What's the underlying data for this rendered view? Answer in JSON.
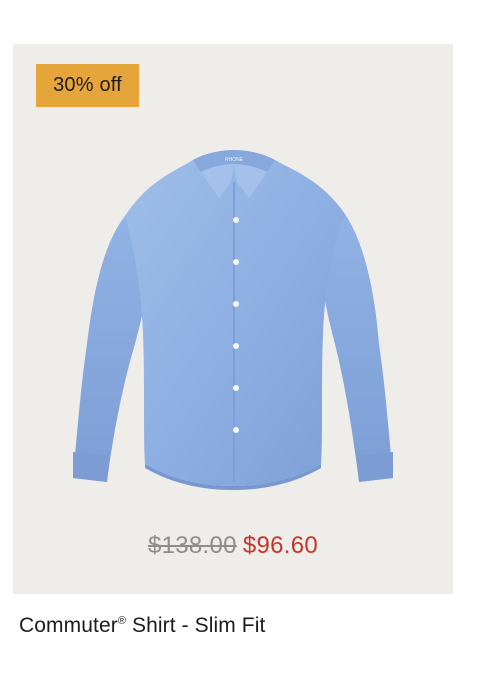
{
  "product": {
    "discount_badge": "30% off",
    "image_alt": "Blue long sleeve button-up shirt",
    "label_on_collar": "RHONE",
    "price_original": "$138.00",
    "price_sale": "$96.60",
    "title_main": "Commuter",
    "title_mark": "®",
    "title_rest": " Shirt - Slim Fit"
  },
  "colors": {
    "card_background": "#efedea",
    "badge_background": "#e6a53b",
    "shirt_blue": "#8fb1e3",
    "sale_price": "#c7352a",
    "original_price": "#8d8d8d"
  },
  "icons": {
    "product_image": "shirt-icon"
  }
}
